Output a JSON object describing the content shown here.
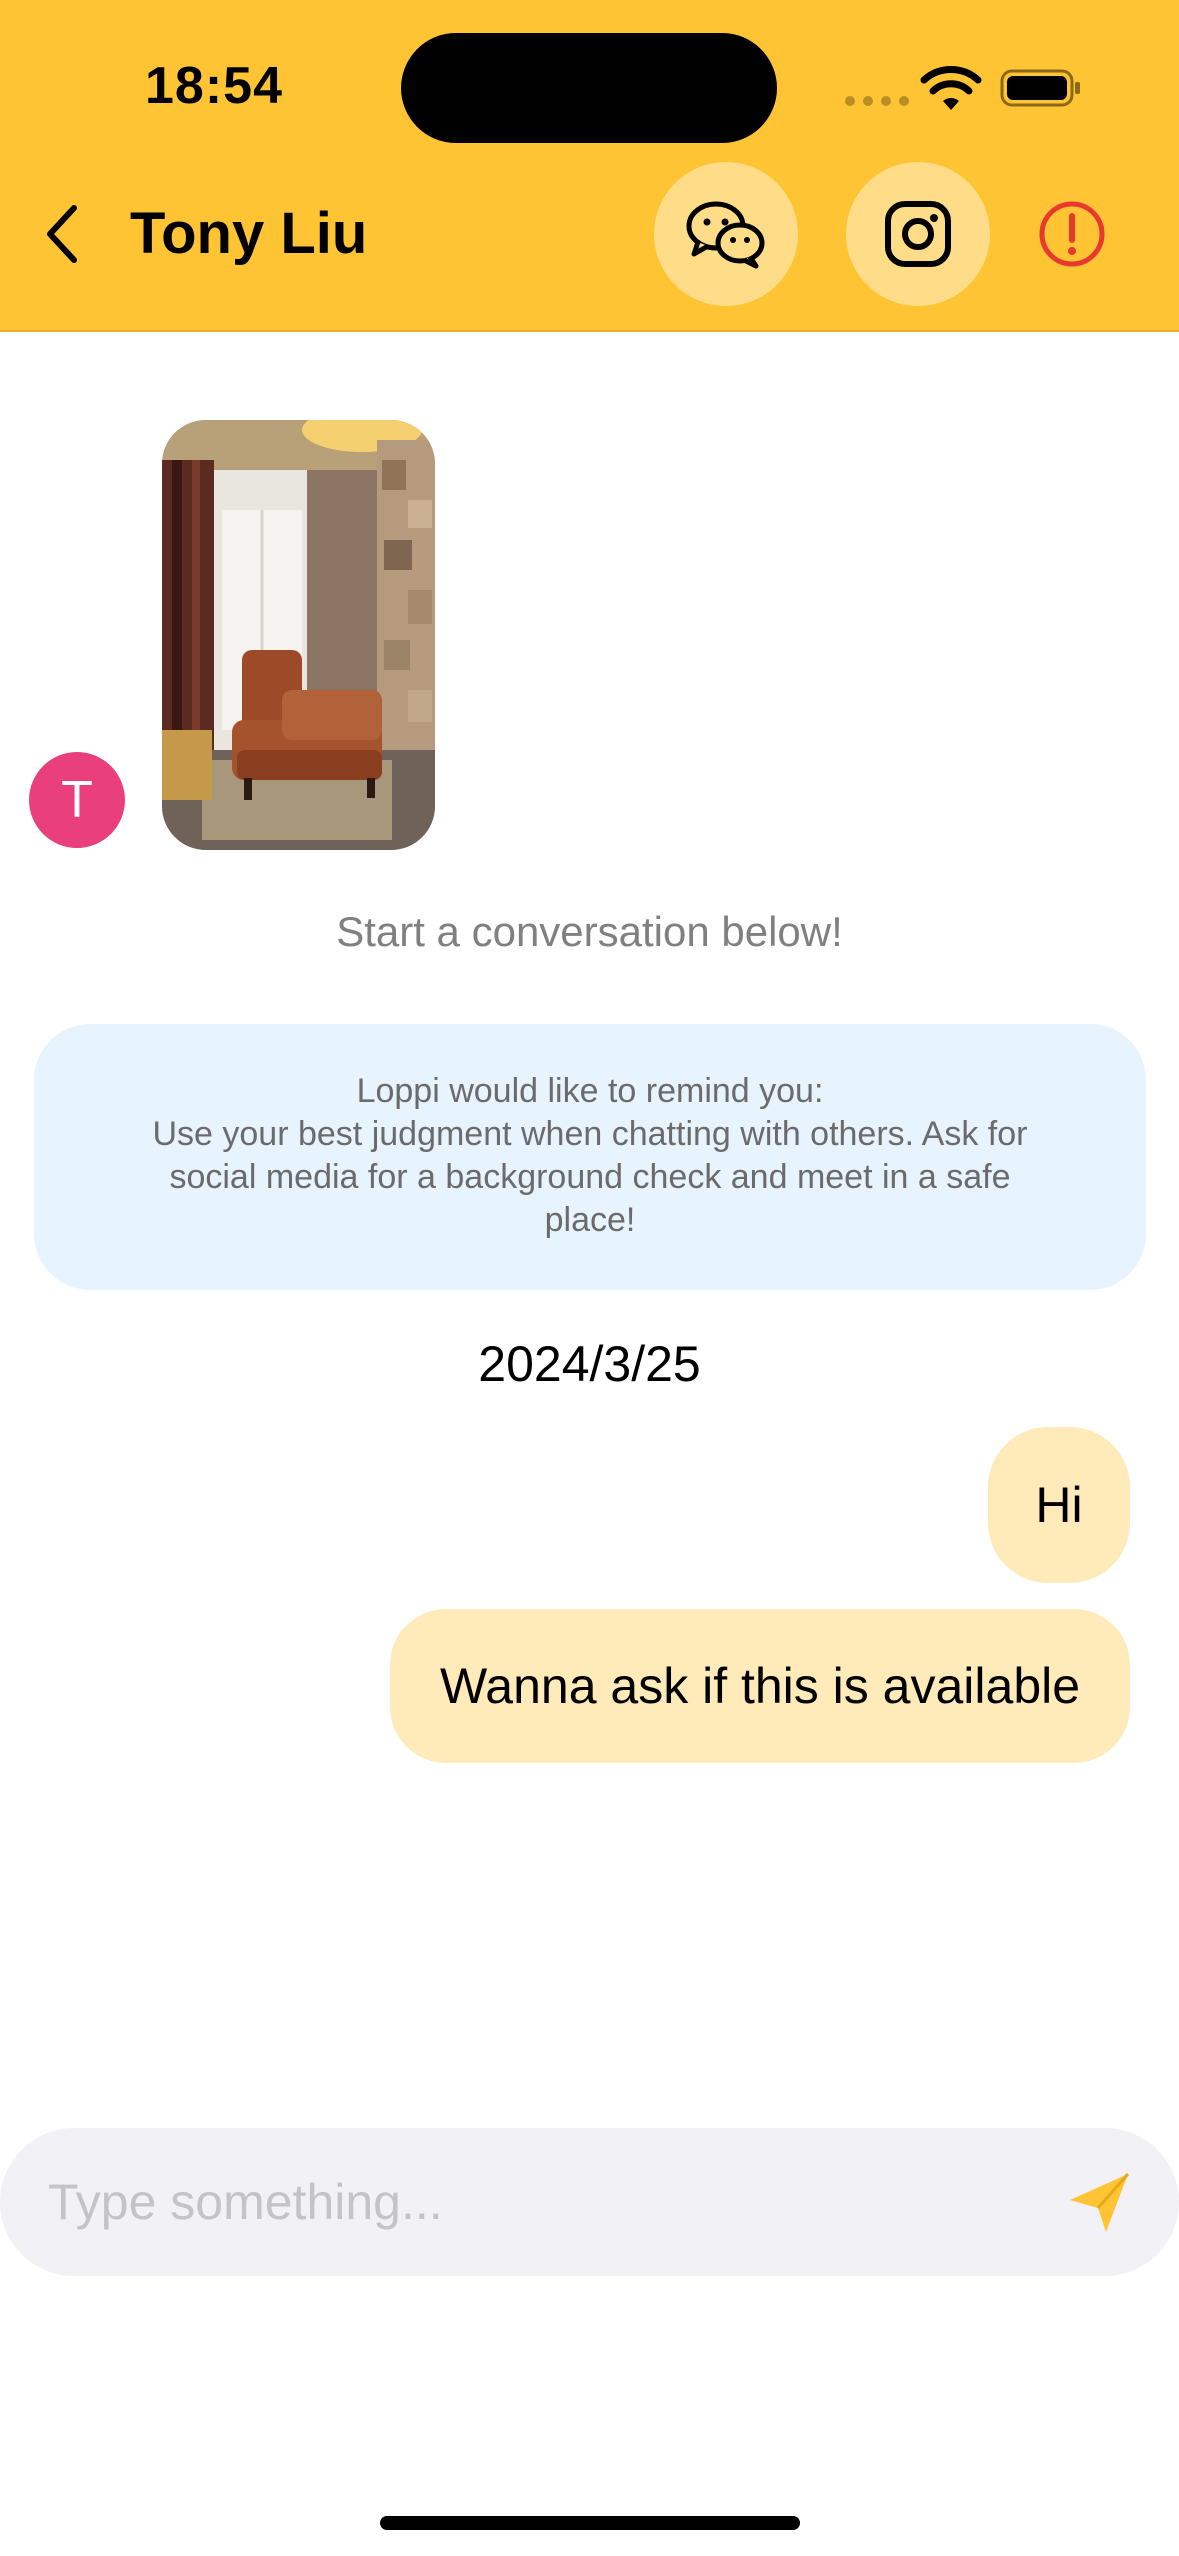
{
  "status_bar": {
    "time": "18:54"
  },
  "header": {
    "title": "Tony Liu",
    "buttons": [
      "back-icon",
      "wechat-icon",
      "instagram-icon",
      "report-icon"
    ],
    "accent_color": "#FFC434",
    "report_color": "#E8392E"
  },
  "conversation": {
    "avatar_initial": "T",
    "avatar_color": "#E9407C",
    "start_text": "Start a conversation below!",
    "reminder": {
      "line1": "Loppi would like to remind you:",
      "line2": "Use your best judgment when chatting with others. Ask for",
      "line3": "social media for a background check and meet in a safe",
      "line4": "place!"
    },
    "date": "2024/3/25",
    "messages": [
      {
        "from": "me",
        "text": "Hi"
      },
      {
        "from": "me",
        "text": "Wanna ask if this is available"
      }
    ]
  },
  "composer": {
    "placeholder": "Type something...",
    "send_icon": "paper-plane-icon"
  }
}
